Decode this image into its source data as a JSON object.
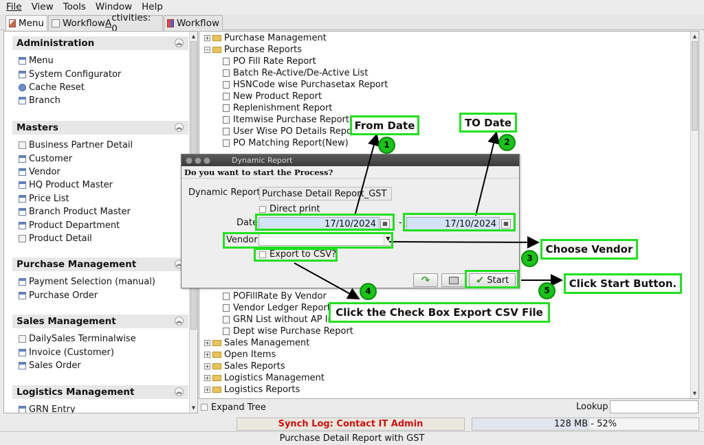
{
  "menubar": {
    "file": "File",
    "view": "View",
    "tools": "Tools",
    "window": "Window",
    "help": "Help"
  },
  "tabs": {
    "menu": "Menu",
    "activities_prefix": "Workflow ",
    "activities_key": "A",
    "activities_rest": "ctivities: 0",
    "workflow": "Workflow"
  },
  "sidebar": {
    "administration": {
      "title": "Administration",
      "items": [
        "Menu",
        "System Configurator",
        "Cache Reset",
        "Branch"
      ]
    },
    "masters": {
      "title": "Masters",
      "items": [
        "Business Partner Detail",
        "Customer",
        "Vendor",
        "HQ Product Master",
        "Price List",
        "Branch Product Master",
        "Product Department",
        "Product Detail"
      ]
    },
    "purchase": {
      "title": "Purchase Management",
      "items": [
        "Payment Selection (manual)",
        "Purchase Order"
      ]
    },
    "sales": {
      "title": "Sales Management",
      "items": [
        "DailySales Terminalwise",
        "Invoice (Customer)",
        "Sales Order"
      ]
    },
    "logistics": {
      "title": "Logistics Management",
      "items": [
        "GRN Entry"
      ]
    }
  },
  "tree": {
    "top": [
      "Purchase Management",
      "Purchase Reports"
    ],
    "reports": [
      "PO Fill Rate Report",
      "Batch Re-Active/De-Active List",
      "HSNCode wise Purchasetax Report",
      "New Product Report",
      "Replenishment Report",
      "Itemwise Purchase Report",
      "User Wise PO Details Report",
      "PO Matching Report(New)"
    ],
    "reports_lower": [
      "POFillRate By Vendor",
      "Vendor Ledger Report",
      "GRN List without AP Invoices",
      "Dept wise Purchase Report"
    ],
    "folders": [
      "Sales Management",
      "Open Items",
      "Sales Reports",
      "Logistics Management",
      "Logistics Reports"
    ]
  },
  "bottom": {
    "expand_tree": "Expand Tree",
    "lookup": "Lookup",
    "synch": "Synch Log: Contact IT Admin",
    "memory": "128 MB - 52%",
    "memory_percent": 52,
    "status": "Purchase Detail Report with GST"
  },
  "dialog": {
    "title": "Dynamic Report",
    "question": "Do you want to start the Process?",
    "report_label": "Dynamic Report",
    "report_value": "Purchase Detail Report_GST",
    "direct_print": "Direct print",
    "date_label": "Date",
    "date_from": "17/10/2024",
    "date_sep": "-",
    "date_to": "17/10/2024",
    "vendor_label": "Vendor",
    "vendor_value": "",
    "export_csv": "Export to CSV?",
    "start": "Start"
  },
  "annotations": {
    "from_date": "From Date",
    "to_date": "TO Date",
    "choose_vendor": "Choose Vendor",
    "check_export": "Click the Check Box Export CSV File",
    "click_start": "Click Start Button.",
    "n1": "1",
    "n2": "2",
    "n3": "3",
    "n4": "4",
    "n5": "5"
  },
  "colors": {
    "annotation_green": "#1fe01f",
    "synch_red": "#d01010",
    "date_field_blue": "#d4e3f6"
  },
  "icons": [
    "window-icon",
    "document-icon",
    "globe-icon",
    "folder-icon",
    "refresh-icon",
    "print-icon",
    "checkmark-icon",
    "calendar-icon"
  ]
}
